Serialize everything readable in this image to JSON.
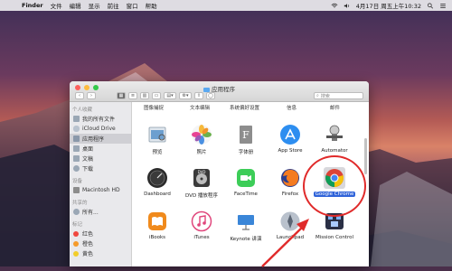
{
  "menubar": {
    "app": "Finder",
    "items": [
      "文件",
      "编辑",
      "显示",
      "前往",
      "窗口",
      "帮助"
    ],
    "clock": "4月17日 周五上午10:32"
  },
  "window": {
    "title": "应用程序",
    "search_placeholder": "搜索"
  },
  "sidebar": {
    "sections": [
      {
        "title": "个人收藏",
        "items": [
          "我的所有文件",
          "iCloud Drive",
          "应用程序",
          "桌面",
          "文稿",
          "下载"
        ]
      },
      {
        "title": "设备",
        "items": [
          "Macintosh HD"
        ]
      },
      {
        "title": "共享的",
        "items": [
          "所有..."
        ]
      },
      {
        "title": "标记",
        "items": [
          "红色",
          "橙色",
          "黄色"
        ]
      }
    ],
    "active": "应用程序"
  },
  "top_labels": [
    "图像捕捉",
    "文本编辑",
    "系统偏好设置",
    "信息",
    "邮件"
  ],
  "apps": [
    {
      "name": "预览"
    },
    {
      "name": "照片"
    },
    {
      "name": "字体册"
    },
    {
      "name": "App Store"
    },
    {
      "name": "Automator"
    },
    {
      "name": "Dashboard"
    },
    {
      "name": "DVD 播放程序"
    },
    {
      "name": "FaceTime"
    },
    {
      "name": "Firefox"
    },
    {
      "name": "Google Chrome"
    },
    {
      "name": "iBooks"
    },
    {
      "name": "iTunes"
    },
    {
      "name": "Keynote 讲演"
    },
    {
      "name": "Launchpad"
    },
    {
      "name": "Mission Control"
    }
  ],
  "colors": {
    "selection": "#2f63d9",
    "annotation": "#e02a2a",
    "tag_red": "#f0473f",
    "tag_orange": "#f59a2a",
    "tag_yellow": "#f2cd2b"
  }
}
